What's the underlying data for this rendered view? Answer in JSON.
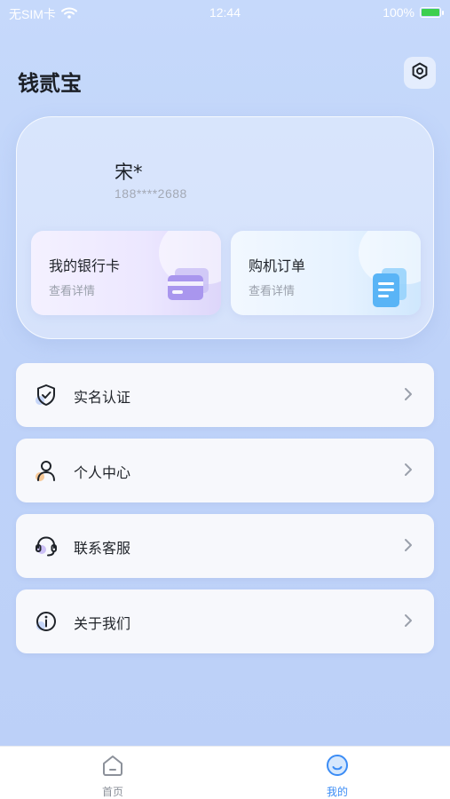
{
  "status_bar": {
    "carrier": "无SIM卡",
    "time": "12:44",
    "battery_percent": "100%"
  },
  "header": {
    "title": "钱贰宝"
  },
  "profile": {
    "name": "宋*",
    "phone": "188****2688"
  },
  "cards": {
    "bank": {
      "title": "我的银行卡",
      "subtitle": "查看详情"
    },
    "order": {
      "title": "购机订单",
      "subtitle": "查看详情"
    }
  },
  "menu": [
    {
      "label": "实名认证",
      "icon": "shield-check-icon"
    },
    {
      "label": "个人中心",
      "icon": "user-icon"
    },
    {
      "label": "联系客服",
      "icon": "headset-icon"
    },
    {
      "label": "关于我们",
      "icon": "info-icon"
    }
  ],
  "tabs": [
    {
      "label": "首页",
      "icon": "home-icon",
      "active": false
    },
    {
      "label": "我的",
      "icon": "profile-face-icon",
      "active": true
    }
  ],
  "colors": {
    "accent": "#3b8cf5",
    "background": "#c6d9fb",
    "battery": "#3ccf4e"
  }
}
